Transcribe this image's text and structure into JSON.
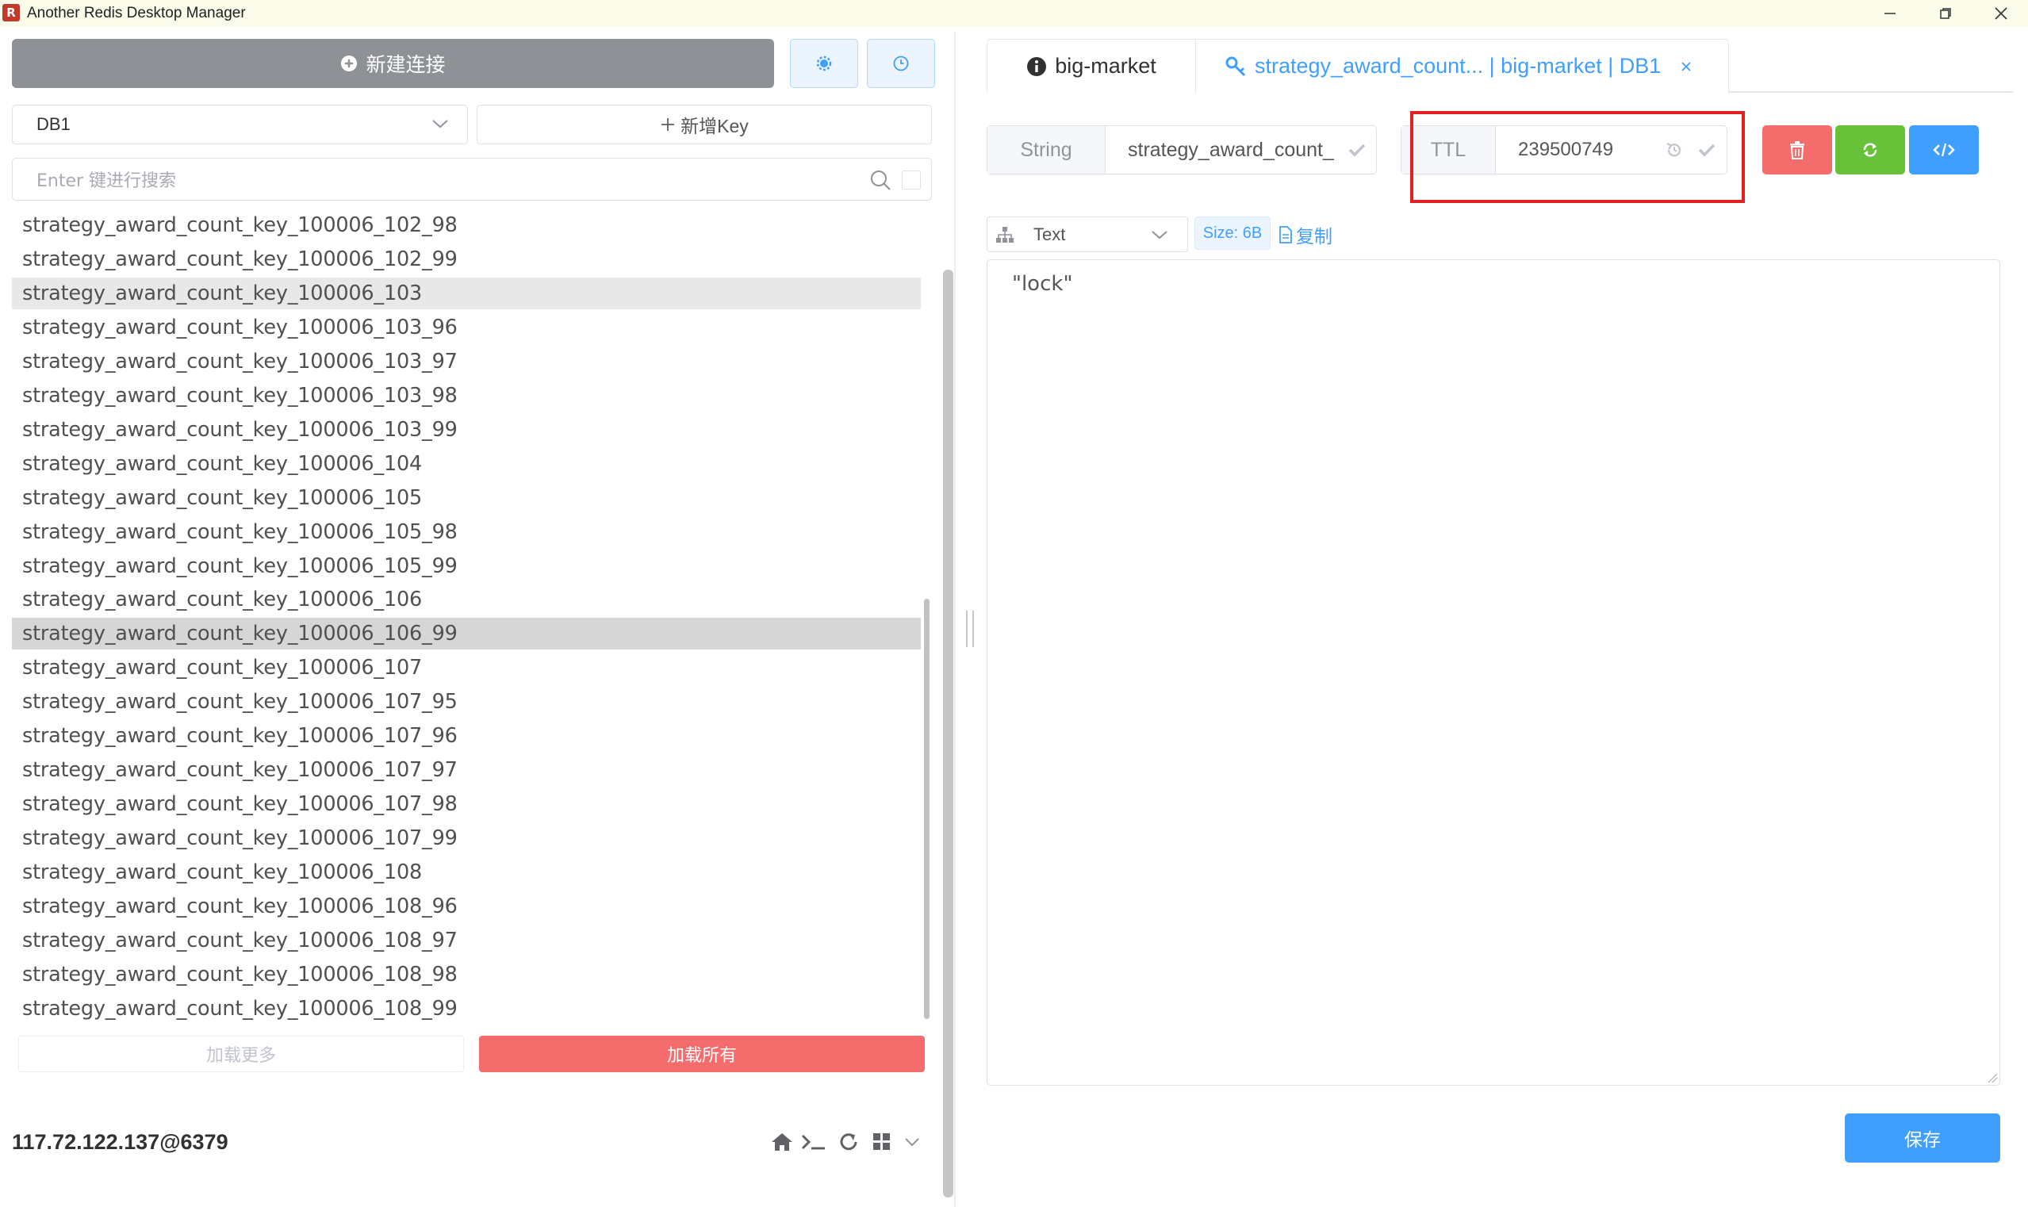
{
  "window": {
    "title": "Another Redis Desktop Manager",
    "icon_glyph": "R"
  },
  "sidebar": {
    "new_connection_label": "新建连接",
    "db_select_value": "DB1",
    "add_key_label": "新增Key",
    "search_placeholder": "Enter 键进行搜索",
    "keys": [
      "strategy_award_count_key_100006_102_98",
      "strategy_award_count_key_100006_102_99",
      "strategy_award_count_key_100006_103",
      "strategy_award_count_key_100006_103_96",
      "strategy_award_count_key_100006_103_97",
      "strategy_award_count_key_100006_103_98",
      "strategy_award_count_key_100006_103_99",
      "strategy_award_count_key_100006_104",
      "strategy_award_count_key_100006_105",
      "strategy_award_count_key_100006_105_98",
      "strategy_award_count_key_100006_105_99",
      "strategy_award_count_key_100006_106",
      "strategy_award_count_key_100006_106_99",
      "strategy_award_count_key_100006_107",
      "strategy_award_count_key_100006_107_95",
      "strategy_award_count_key_100006_107_96",
      "strategy_award_count_key_100006_107_97",
      "strategy_award_count_key_100006_107_98",
      "strategy_award_count_key_100006_107_99",
      "strategy_award_count_key_100006_108",
      "strategy_award_count_key_100006_108_96",
      "strategy_award_count_key_100006_108_97",
      "strategy_award_count_key_100006_108_98",
      "strategy_award_count_key_100006_108_99"
    ],
    "load_more_label": "加载更多",
    "load_all_label": "加载所有",
    "connection_address": "117.72.122.137@6379"
  },
  "tabs": [
    {
      "label": "big-market",
      "icon": "info-icon"
    },
    {
      "label": "strategy_award_count... | big-market | DB1",
      "icon": "key-icon"
    }
  ],
  "key_detail": {
    "type_label": "String",
    "key_name": "strategy_award_count_",
    "ttl_label": "TTL",
    "ttl_value": "239500749",
    "format_value": "Text",
    "size_label": "Size: 6B",
    "copy_label": "复制",
    "value_text": "\"lock\"",
    "save_label": "保存"
  },
  "colors": {
    "accent": "#409eff",
    "danger": "#f56c6c",
    "success": "#67c23a",
    "highlight_box": "#e32121"
  }
}
